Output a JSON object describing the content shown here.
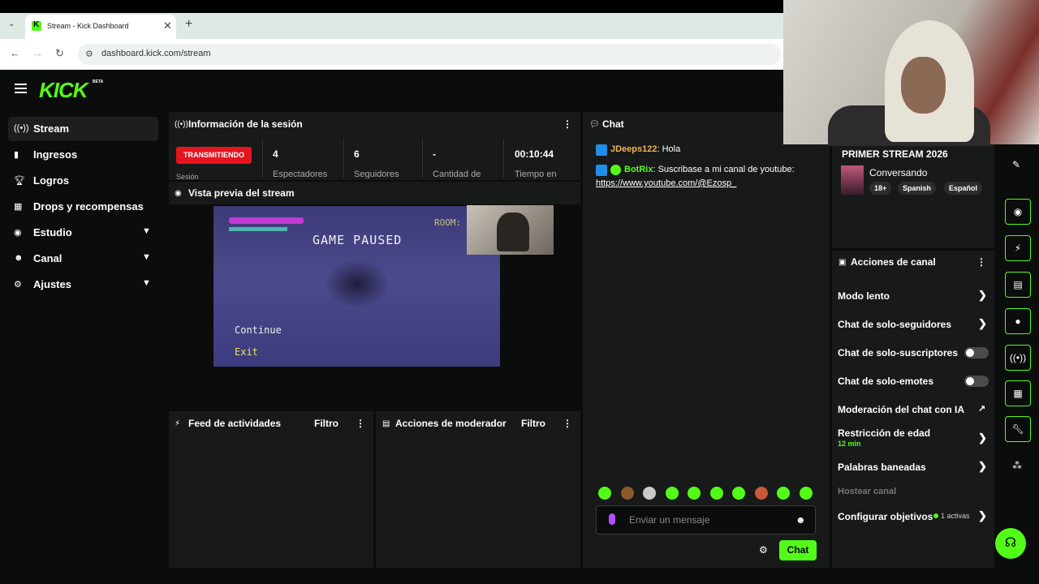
{
  "browser": {
    "tab_title": "Stream - Kick Dashboard",
    "url": "dashboard.kick.com/stream",
    "tab_close": "✕",
    "new_tab": "+"
  },
  "header": {
    "logo": "KICK",
    "logo_badge": "BETA"
  },
  "sidebar": {
    "items": [
      {
        "label": "Stream",
        "icon": "broadcast-icon",
        "expandable": false
      },
      {
        "label": "Ingresos",
        "icon": "bar-chart-icon",
        "expandable": false
      },
      {
        "label": "Logros",
        "icon": "trophy-icon",
        "expandable": false
      },
      {
        "label": "Drops y recompensas",
        "icon": "gift-icon",
        "expandable": false
      },
      {
        "label": "Estudio",
        "icon": "camera-icon",
        "expandable": true
      },
      {
        "label": "Canal",
        "icon": "users-icon",
        "expandable": true
      },
      {
        "label": "Ajustes",
        "icon": "gear-icon",
        "expandable": true
      }
    ]
  },
  "session": {
    "title": "Información de la sesión",
    "status": "TRANSMITIENDO",
    "stats": [
      {
        "value": "4",
        "label": "Espectadores"
      },
      {
        "value": "6",
        "label": "Seguidores"
      },
      {
        "value": "-",
        "label": "Cantidad de"
      },
      {
        "value": "00:10:44",
        "label": "Tiempo en"
      }
    ],
    "status_label": "Sesión"
  },
  "preview": {
    "title": "Vista previa del stream",
    "game_paused": "GAME PAUSED",
    "game_room": "ROOM:",
    "game_continue": "Continue",
    "game_exit": "Exit"
  },
  "feed": {
    "title": "Feed de actividades",
    "filter": "Filtro"
  },
  "modactions": {
    "title": "Acciones de moderador",
    "filter": "Filtro"
  },
  "chat": {
    "title": "Chat",
    "messages": [
      {
        "user": "JDeeps122",
        "text": ": Hola"
      },
      {
        "user": "BotRix",
        "text": ": Suscribase a mi canal de youtube:",
        "link": "https://www.youtube.com/@Ezosp_"
      }
    ],
    "placeholder": "Enviar un mensaje",
    "send_label": "Chat"
  },
  "channel": {
    "stream_title": "PRIMER STREAM 2026",
    "category": "Conversando",
    "tags": [
      "18+",
      "Spanish",
      "Español"
    ]
  },
  "channel_actions": {
    "title": "Acciones de canal",
    "slow_mode": "Modo lento",
    "followers_only": "Chat de solo-seguidores",
    "subscribers_only": "Chat de solo-suscriptores",
    "emotes_only": "Chat de solo-emotes",
    "ai_moderation": "Moderación del chat con IA",
    "age_restriction": "Restricción de edad",
    "age_restriction_value": "12 min",
    "banned_words": "Palabras baneadas",
    "host_channel": "Hostear canal",
    "goals": "Configurar objetivos",
    "goals_active": "1 activas"
  },
  "colors": {
    "accent": "#53fc18",
    "live": "#e5141f",
    "panel": "#181a1a",
    "background": "#0b0c0c"
  }
}
